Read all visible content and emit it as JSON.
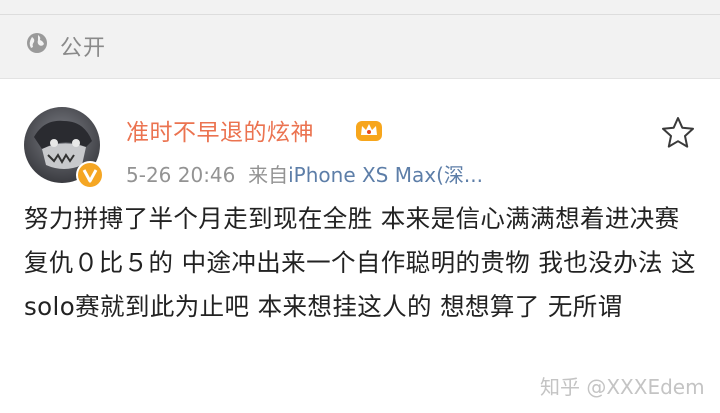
{
  "visibility": {
    "label": "公开",
    "icon": "globe-icon"
  },
  "post": {
    "author": "准时不早退的炫神",
    "time": "5-26 20:46",
    "source_prefix": "来自",
    "source": "iPhone XS Max(深...",
    "text": "努力拼搏了半个月走到现在全胜 本来是信心满满想着进决赛复仇０比５的 中途冲出来一个自作聪明的贵物 我也没办法 这solo赛就到此为止吧 本来想挂这人的 想想算了 无所谓"
  },
  "watermark": "知乎 @XXXEdem",
  "colors": {
    "username": "#eb7350",
    "badge": "#f5a623",
    "source_link": "#5d7ea8"
  }
}
